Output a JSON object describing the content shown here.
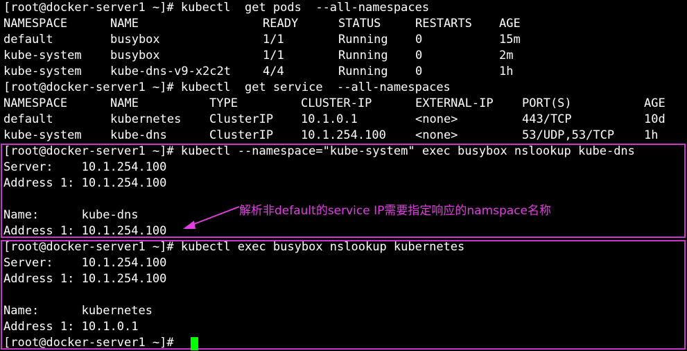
{
  "colors": {
    "background": "#000000",
    "text": "#ffffff",
    "highlight_border": "#cc33cc",
    "annotation": "#e13ee1",
    "cursor": "#00ff00"
  },
  "commands": {
    "get_pods": "[root@docker-server1 ~]# kubectl  get pods  --all-namespaces",
    "get_service": "[root@docker-server1 ~]# kubectl  get service  --all-namespaces",
    "nslookup_kube_dns": "[root@docker-server1 ~]# kubectl --namespace=\"kube-system\" exec busybox nslookup kube-dns",
    "nslookup_kubernetes": "[root@docker-server1 ~]# kubectl exec busybox nslookup kubernetes",
    "final_prompt": "[root@docker-server1 ~]# "
  },
  "pods_table": {
    "headers": [
      "NAMESPACE",
      "NAME",
      "READY",
      "STATUS",
      "RESTARTS",
      "AGE"
    ],
    "rows": [
      [
        "default",
        "busybox",
        "1/1",
        "Running",
        "0",
        "15m"
      ],
      [
        "kube-system",
        "busybox",
        "1/1",
        "Running",
        "0",
        "2m"
      ],
      [
        "kube-system",
        "kube-dns-v9-x2c2t",
        "4/4",
        "Running",
        "0",
        "1h"
      ]
    ]
  },
  "service_table": {
    "headers": [
      "NAMESPACE",
      "NAME",
      "TYPE",
      "CLUSTER-IP",
      "EXTERNAL-IP",
      "PORT(S)",
      "AGE"
    ],
    "rows": [
      [
        "default",
        "kubernetes",
        "ClusterIP",
        "10.1.0.1",
        "<none>",
        "443/TCP",
        "10d"
      ],
      [
        "kube-system",
        "kube-dns",
        "ClusterIP",
        "10.1.254.100",
        "<none>",
        "53/UDP,53/TCP",
        "1h"
      ]
    ]
  },
  "nslookup_kube_dns": {
    "server_line": "Server:    10.1.254.100",
    "address_line": "Address 1: 10.1.254.100",
    "name_line": "Name:      kube-dns",
    "name_address_line": "Address 1: 10.1.254.100"
  },
  "nslookup_kubernetes": {
    "server_line": "Server:    10.1.254.100",
    "address_line": "Address 1: 10.1.254.100",
    "name_line": "Name:      kubernetes",
    "name_address_line": "Address 1: 10.1.0.1"
  },
  "annotation": {
    "text": "解析非default的service IP需要指定响应的namspace名称"
  }
}
